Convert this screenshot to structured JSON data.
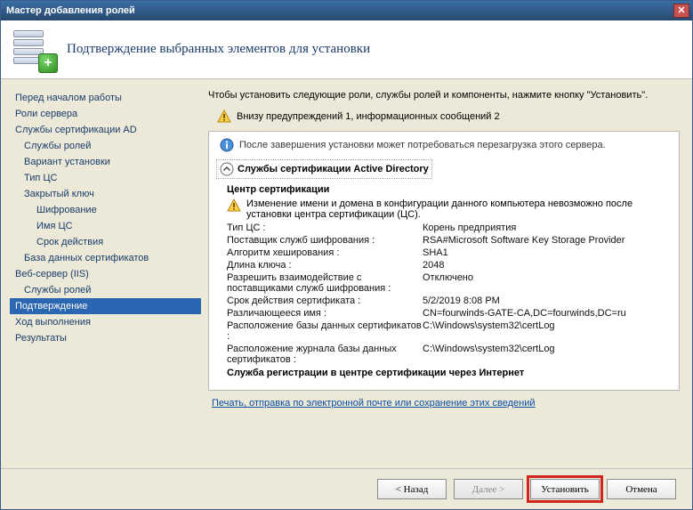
{
  "titlebar": {
    "title": "Мастер добавления ролей"
  },
  "header": {
    "title": "Подтверждение выбранных элементов для установки"
  },
  "sidebar": {
    "items": [
      {
        "label": "Перед началом работы",
        "level": 0
      },
      {
        "label": "Роли сервера",
        "level": 0
      },
      {
        "label": "Службы сертификации AD",
        "level": 0
      },
      {
        "label": "Службы ролей",
        "level": 1
      },
      {
        "label": "Вариант установки",
        "level": 1
      },
      {
        "label": "Тип ЦС",
        "level": 1
      },
      {
        "label": "Закрытый ключ",
        "level": 1
      },
      {
        "label": "Шифрование",
        "level": 2
      },
      {
        "label": "Имя ЦС",
        "level": 2
      },
      {
        "label": "Срок действия",
        "level": 2
      },
      {
        "label": "База данных сертификатов",
        "level": 1
      },
      {
        "label": "Веб-сервер (IIS)",
        "level": 0
      },
      {
        "label": "Службы ролей",
        "level": 1
      },
      {
        "label": "Подтверждение",
        "level": 0,
        "active": true
      },
      {
        "label": "Ход выполнения",
        "level": 0
      },
      {
        "label": "Результаты",
        "level": 0
      }
    ]
  },
  "main": {
    "intro": "Чтобы установить следующие роли, службы ролей и компоненты, нажмите кнопку \"Установить\".",
    "warning_summary": "Внизу предупреждений 1, информационных сообщений 2",
    "info_reboot": "После завершения установки может потребоваться перезагрузка этого сервера.",
    "branding": "Службы сертификации Active Directory",
    "section_ca": "Центр сертификации",
    "ca_warning": "Изменение имени и домена в конфигурации данного компьютера невозможно после установки центра сертификации (ЦС).",
    "kv": [
      {
        "k": "Тип ЦС :",
        "v": "Корень предприятия"
      },
      {
        "k": "Поставщик служб шифрования :",
        "v": "RSA#Microsoft Software Key Storage Provider"
      },
      {
        "k": "Алгоритм хеширования :",
        "v": "SHA1"
      },
      {
        "k": "Длина ключа :",
        "v": "2048"
      },
      {
        "k": "Разрешить взаимодействие с поставщиками служб шифрования :",
        "v": "Отключено"
      },
      {
        "k": "Срок действия сертификата :",
        "v": "5/2/2019 8:08 PM"
      },
      {
        "k": "Различающееся имя :",
        "v": "CN=fourwinds-GATE-CA,DC=fourwinds,DC=ru"
      },
      {
        "k": "Расположение базы данных сертификатов :",
        "v": "C:\\Windows\\system32\\certLog"
      },
      {
        "k": "Расположение журнала базы данных сертификатов :",
        "v": "C:\\Windows\\system32\\certLog"
      }
    ],
    "section_web_enroll": "Служба регистрации в центре сертификации через Интернет",
    "link": "Печать, отправка по электронной почте или сохранение этих сведений"
  },
  "footer": {
    "back": "< Назад",
    "next": "Далее >",
    "install": "Установить",
    "cancel": "Отмена"
  }
}
